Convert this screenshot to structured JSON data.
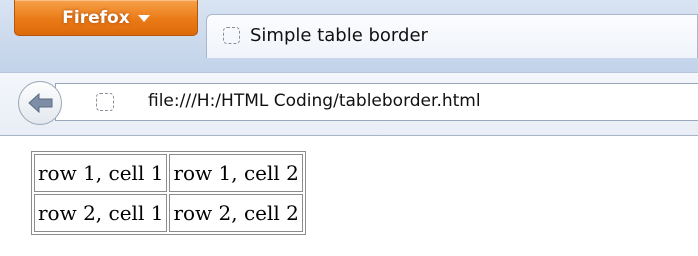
{
  "browser": {
    "menu_button": "Firefox",
    "tab": {
      "title": "Simple table border"
    },
    "address": "file:///H:/HTML Coding/tableborder.html"
  },
  "page": {
    "table": {
      "rows": [
        [
          "row 1, cell 1",
          "row 1, cell 2"
        ],
        [
          "row 2, cell 1",
          "row 2, cell 2"
        ]
      ]
    }
  },
  "colors": {
    "firefox_button": "#ea7a16",
    "chrome_background": "#cbd9ec",
    "table_border": "#8c8c8c"
  },
  "icons": {
    "back": "left-arrow-icon",
    "tab_favicon": "placeholder-page-icon",
    "url_favicon": "placeholder-page-icon",
    "menu_dropdown": "caret-down-icon"
  }
}
